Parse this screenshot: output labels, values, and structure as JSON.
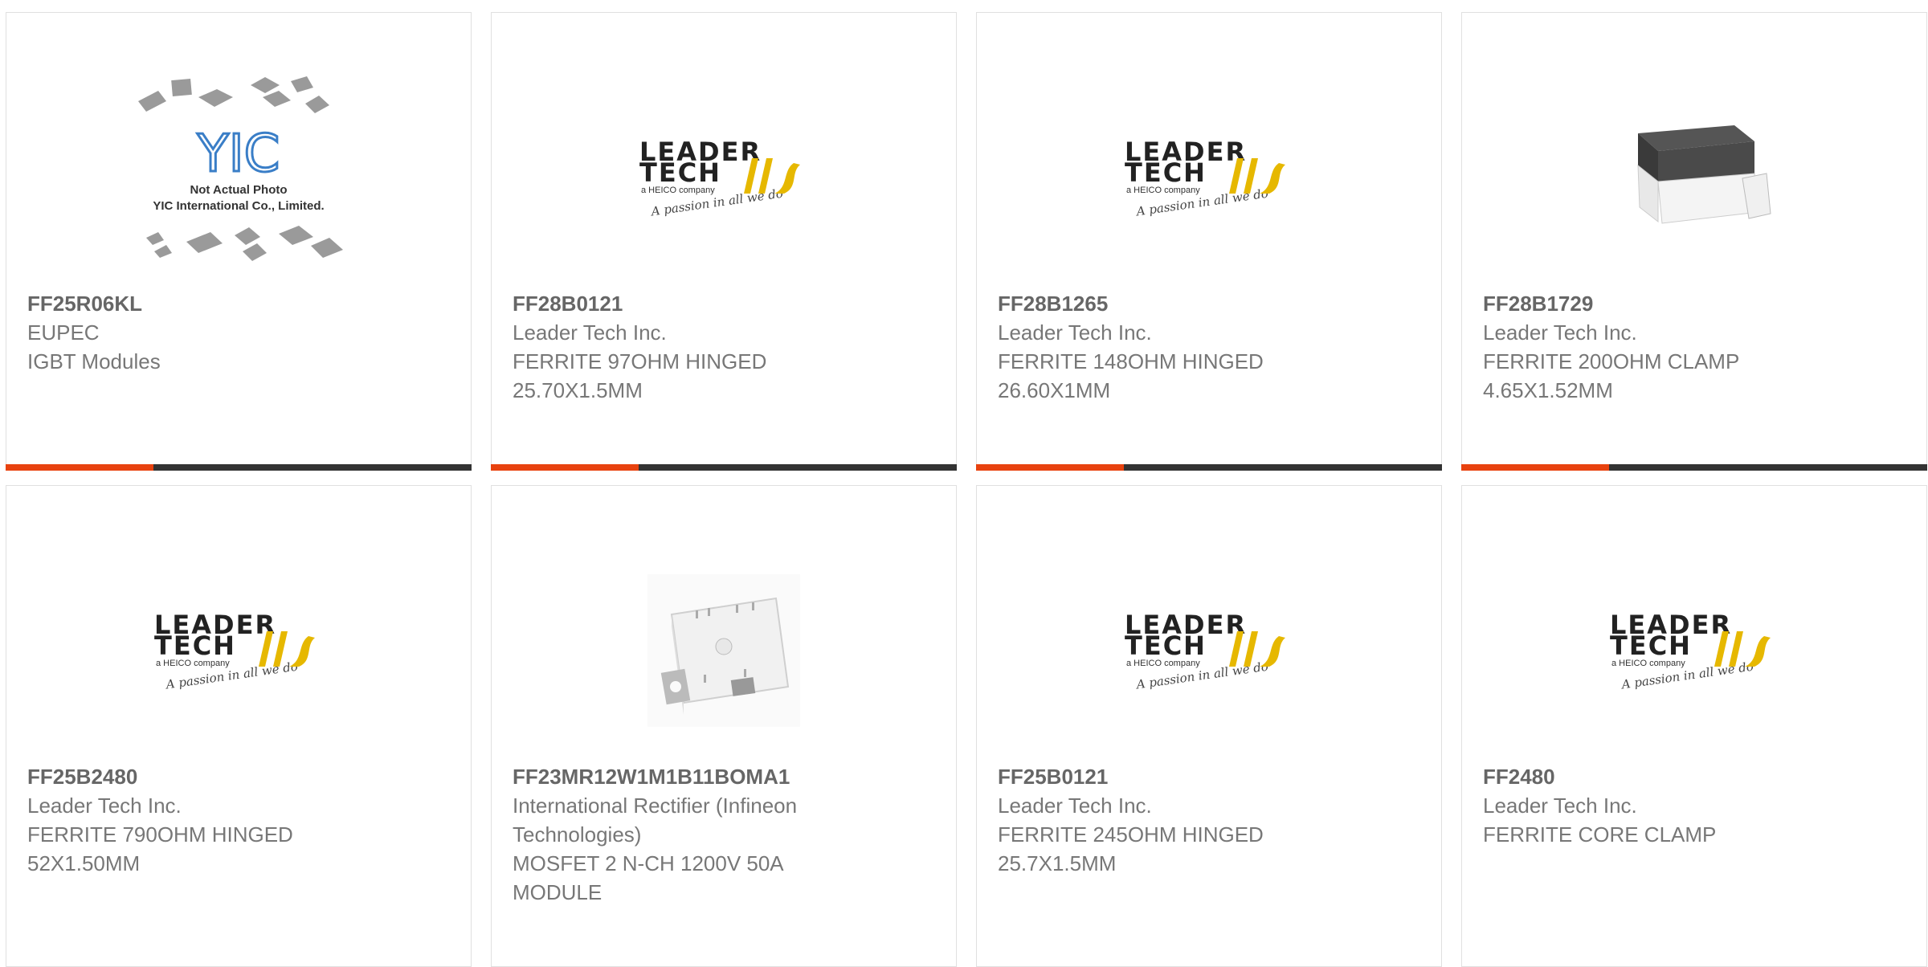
{
  "products": [
    {
      "part": "FF25R06KL",
      "maker": "EUPEC",
      "desc": [
        "IGBT Modules"
      ],
      "image": "yic-placeholder",
      "placeholder_text": [
        "Not Actual Photo",
        "YIC International Co., Limited."
      ],
      "placeholder_logo": "YIC"
    },
    {
      "part": "FF28B0121",
      "maker": "Leader Tech Inc.",
      "desc": [
        "FERRITE 97OHM HINGED",
        "25.70X1.5MM"
      ],
      "image": "leader-tech-logo"
    },
    {
      "part": "FF28B1265",
      "maker": "Leader Tech Inc.",
      "desc": [
        "FERRITE 148OHM HINGED",
        "26.60X1MM"
      ],
      "image": "leader-tech-logo"
    },
    {
      "part": "FF28B1729",
      "maker": "Leader Tech Inc.",
      "desc": [
        "FERRITE 200OHM CLAMP",
        "4.65X1.52MM"
      ],
      "image": "ferrite-clamp-photo"
    },
    {
      "part": "FF25B2480",
      "maker": "Leader Tech Inc.",
      "desc": [
        "FERRITE 790OHM HINGED",
        "52X1.50MM"
      ],
      "image": "leader-tech-logo"
    },
    {
      "part": "FF23MR12W1M1B11BOMA1",
      "maker_lines": [
        "International Rectifier (Infineon",
        "Technologies)"
      ],
      "desc": [
        "MOSFET 2 N-CH 1200V 50A",
        "MODULE"
      ],
      "image": "power-module-photo"
    },
    {
      "part": "FF25B0121",
      "maker": "Leader Tech Inc.",
      "desc": [
        "FERRITE 245OHM HINGED",
        "25.7X1.5MM"
      ],
      "image": "leader-tech-logo"
    },
    {
      "part": "FF2480",
      "maker": "Leader Tech Inc.",
      "desc": [
        "FERRITE CORE CLAMP"
      ],
      "image": "leader-tech-logo"
    }
  ],
  "logo": {
    "line1": "LEADER",
    "line2": "TECH",
    "sub": "a HEICO company",
    "tagline": "A passion in all we do"
  },
  "colors": {
    "accent": "#e8420f",
    "bar": "#333333",
    "text": "#777777"
  }
}
